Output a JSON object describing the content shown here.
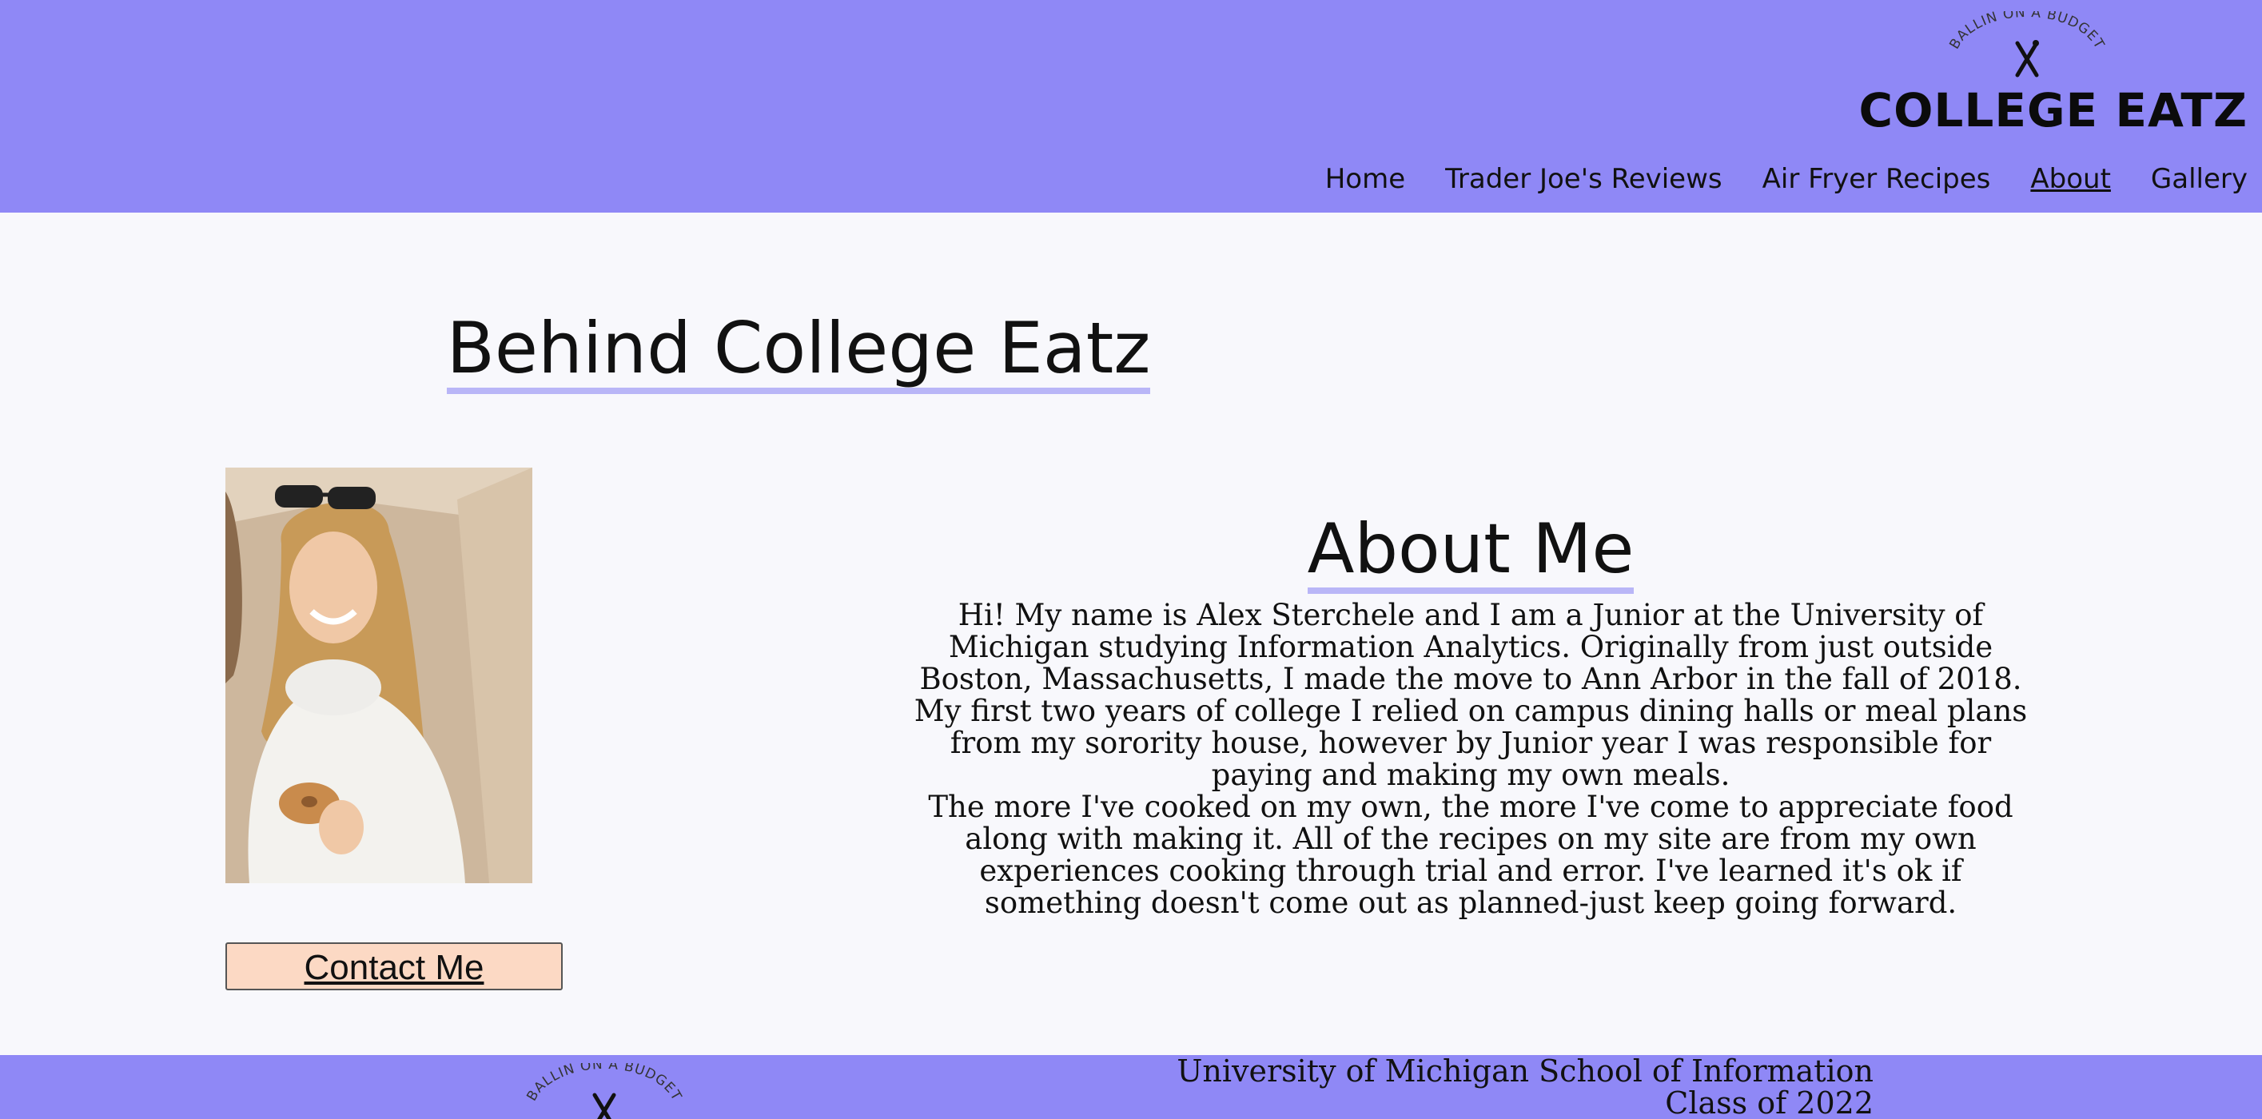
{
  "brand": {
    "tagline": "BALLIN ON A BUDGET",
    "title": "COLLEGE EATZ"
  },
  "nav": {
    "items": [
      {
        "label": "Home"
      },
      {
        "label": "Trader Joe's Reviews"
      },
      {
        "label": "Air Fryer Recipes"
      },
      {
        "label": "About"
      },
      {
        "label": "Gallery"
      }
    ],
    "active": "About"
  },
  "page": {
    "title": "Behind College Eatz"
  },
  "about": {
    "heading": "About Me",
    "paragraphs": [
      "Hi! My name is Alex Sterchele and I am a Junior at the University of Michigan studying Information Analytics. Originally from just outside Boston, Massachusetts, I made the move to Ann Arbor in the fall of 2018. My first two years of college I relied on campus dining halls or meal plans from my sorority house, however by Junior year I was responsible for paying and making my own meals.",
      "The more I've cooked on my own, the more I've come to appreciate food along with making it. All of the recipes on my site are from my own experiences cooking through trial and error. I've learned it's ok if something doesn't come out as planned-just keep going forward."
    ],
    "contact_label": "Contact Me"
  },
  "footer": {
    "line1": "University of Michigan School of Information",
    "line2": "Class of 2022"
  },
  "colors": {
    "header_bg": "#8f88f6",
    "page_bg": "#f8f8fc",
    "underline_accent": "#b9b6f7",
    "contact_button_bg": "#fcd9c4"
  }
}
